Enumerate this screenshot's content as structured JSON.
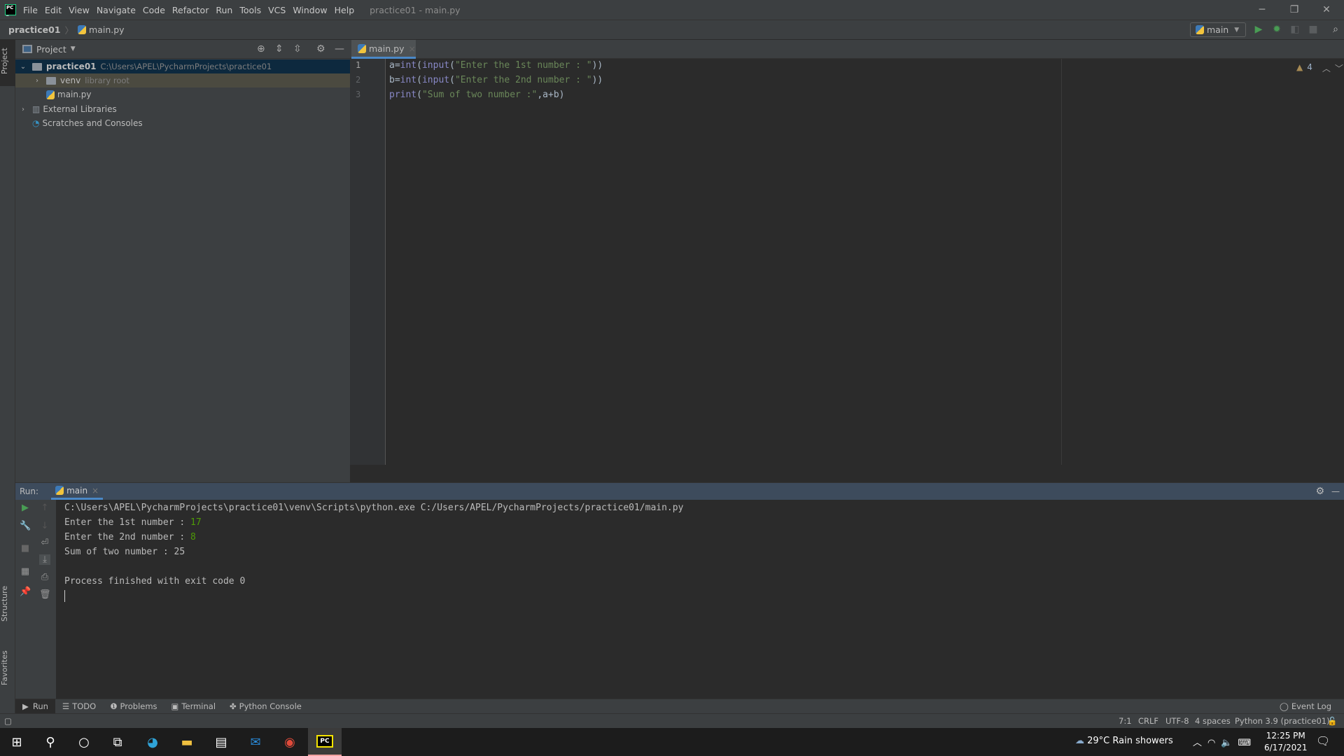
{
  "window": {
    "title": "practice01 - main.py",
    "menu": [
      "File",
      "Edit",
      "View",
      "Navigate",
      "Code",
      "Refactor",
      "Run",
      "Tools",
      "VCS",
      "Window",
      "Help"
    ]
  },
  "breadcrumb": {
    "project": "practice01",
    "file": "main.py"
  },
  "toolbar": {
    "run_config": "main"
  },
  "left_stripe": {
    "project": "Project",
    "structure": "Structure",
    "favorites": "Favorites"
  },
  "project_panel": {
    "title": "Project",
    "tree": [
      {
        "label": "practice01",
        "detail": "C:\\Users\\APEL\\PycharmProjects\\practice01"
      },
      {
        "label": "venv",
        "detail": "library root"
      },
      {
        "label": "main.py"
      },
      {
        "label": "External Libraries"
      },
      {
        "label": "Scratches and Consoles"
      }
    ]
  },
  "editor": {
    "tab": "main.py",
    "warnings": "4",
    "lines": [
      {
        "num": "1",
        "pre": "a=",
        "fn": "int",
        "p1": "(",
        "fn2": "input",
        "p2": "(",
        "str": "\"Enter the 1st number : \"",
        "post": "))"
      },
      {
        "num": "2",
        "pre": "b=",
        "fn": "int",
        "p1": "(",
        "fn2": "input",
        "p2": "(",
        "str": "\"Enter the 2nd number : \"",
        "post": "))"
      },
      {
        "num": "3",
        "pre": "",
        "fn": "print",
        "p1": "(",
        "fn2": "",
        "p2": "",
        "str": "\"Sum of two number :\"",
        "post": ",a+b)"
      }
    ]
  },
  "run": {
    "label": "Run:",
    "tab": "main",
    "output": {
      "cmd": "C:\\Users\\APEL\\PycharmProjects\\practice01\\venv\\Scripts\\python.exe C:/Users/APEL/PycharmProjects/practice01/main.py",
      "l1": "Enter the 1st number : ",
      "v1": "17",
      "l2": "Enter the 2nd number : ",
      "v2": "8",
      "l3": "Sum of two number : 25",
      "l4": "Process finished with exit code 0"
    }
  },
  "bottom_tabs": [
    "Run",
    "TODO",
    "Problems",
    "Terminal",
    "Python Console"
  ],
  "event_log": "Event Log",
  "status": {
    "position": "7:1",
    "line_sep": "CRLF",
    "encoding": "UTF-8",
    "indent": "4 spaces",
    "interpreter": "Python 3.9 (practice01)"
  },
  "taskbar": {
    "weather": "29°C  Rain showers",
    "time": "12:25 PM",
    "date": "6/17/2021"
  }
}
